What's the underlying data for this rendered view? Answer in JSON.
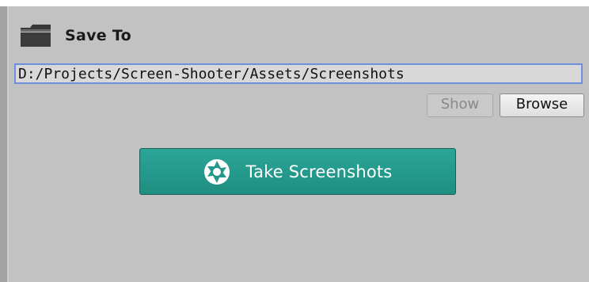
{
  "header": {
    "icon": "folder-icon",
    "title": "Save To"
  },
  "path": {
    "value": "D:/Projects/Screen-Shooter/Assets/Screenshots"
  },
  "buttons": {
    "show_label": "Show",
    "browse_label": "Browse",
    "take_screenshots_label": "Take Screenshots",
    "take_screenshots_icon": "aperture-icon"
  },
  "colors": {
    "panel_bg": "#c2c2c2",
    "field_focus_border": "#6f8fde",
    "primary_button": "#24998b"
  }
}
